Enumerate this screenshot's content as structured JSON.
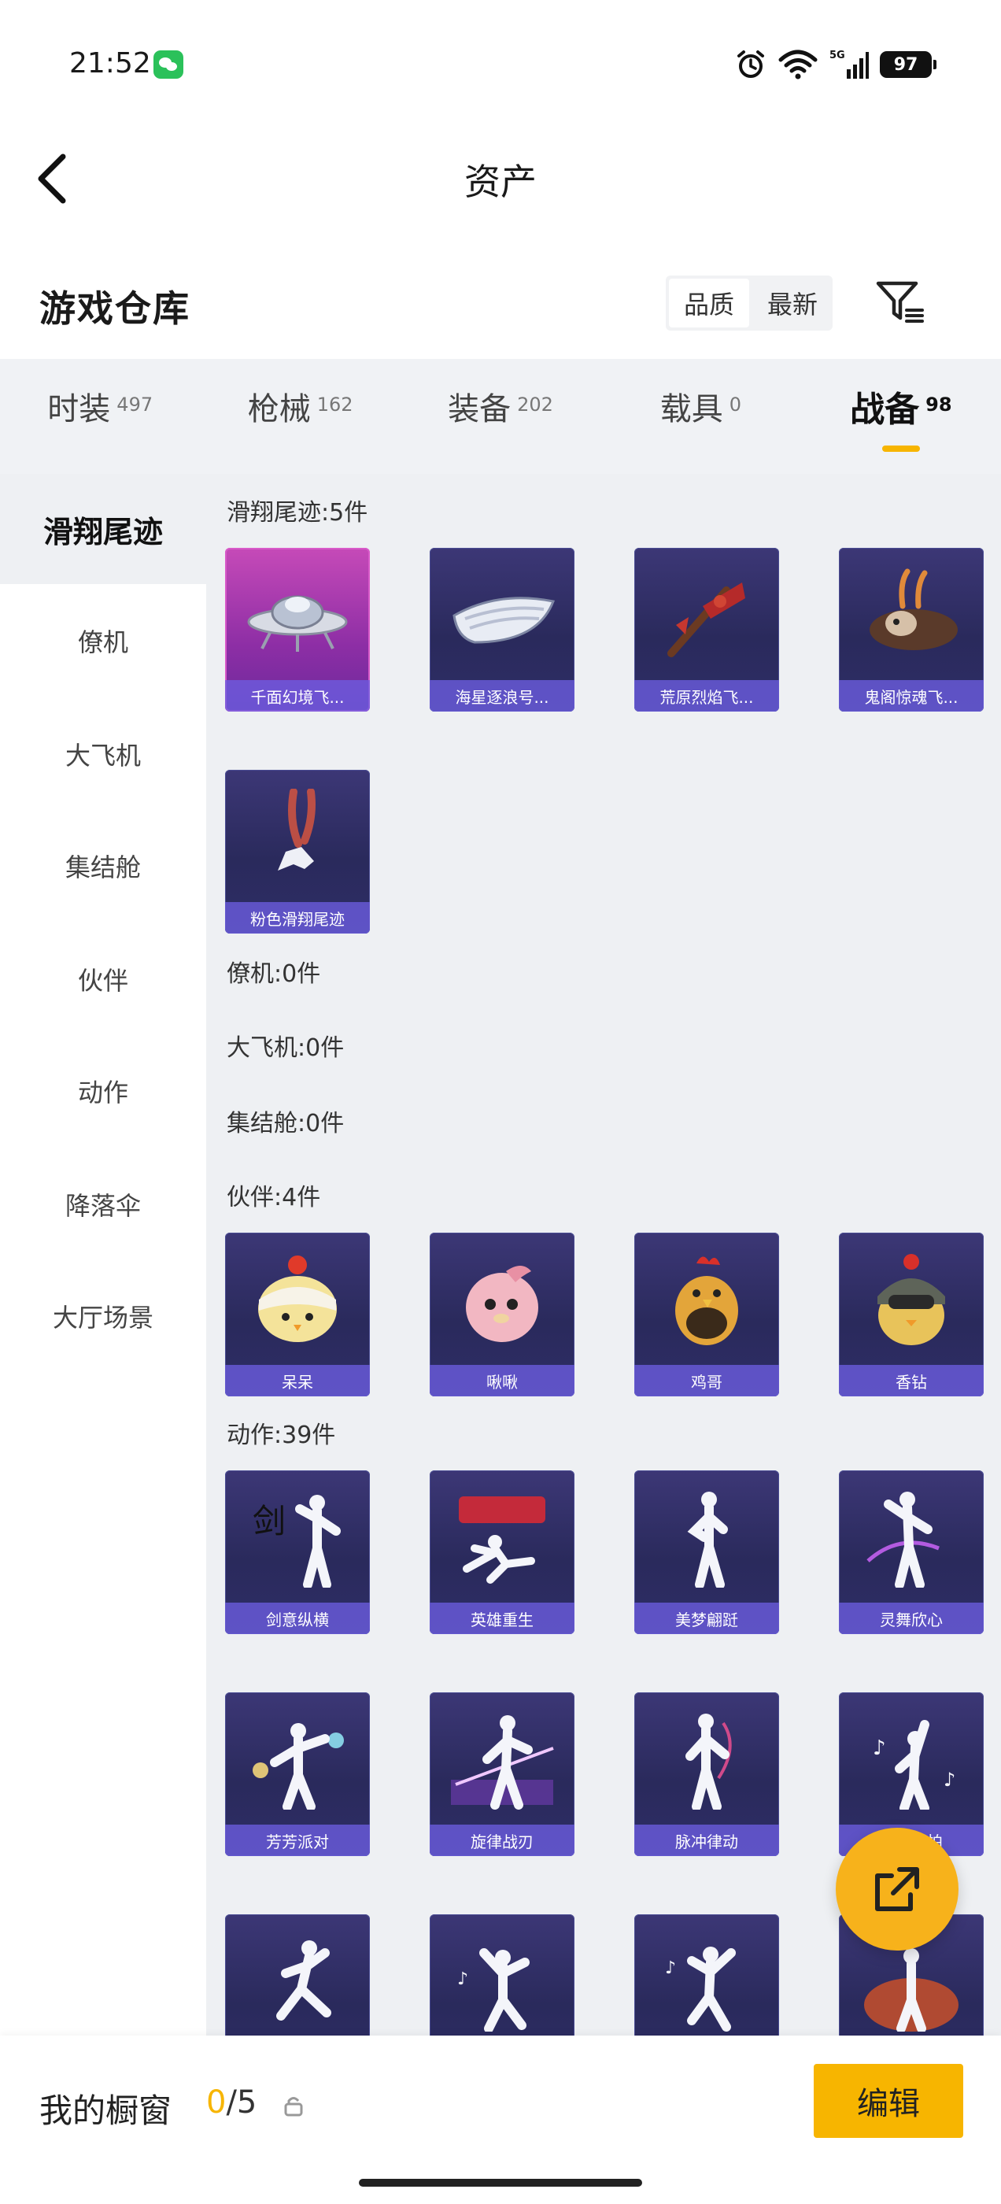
{
  "status_bar": {
    "time": "21:52",
    "network": "5G",
    "battery": "97"
  },
  "nav": {
    "title": "资产"
  },
  "section": {
    "title": "游戏仓库",
    "sort_options": [
      "品质",
      "最新"
    ]
  },
  "tabs": [
    {
      "label": "时装",
      "count": "497"
    },
    {
      "label": "枪械",
      "count": "162"
    },
    {
      "label": "装备",
      "count": "202"
    },
    {
      "label": "载具",
      "count": "0"
    },
    {
      "label": "战备",
      "count": "98",
      "active": true
    }
  ],
  "sidebar": {
    "items": [
      "滑翔尾迹",
      "僚机",
      "大飞机",
      "集结舱",
      "伙伴",
      "动作",
      "降落伞",
      "大厅场景"
    ]
  },
  "groups": {
    "trail": {
      "title": "滑翔尾迹:5件",
      "items": [
        "千面幻境飞...",
        "海星逐浪号...",
        "荒原烈焰飞...",
        "鬼阁惊魂飞...",
        "粉色滑翔尾迹"
      ]
    },
    "wingman": {
      "title": "僚机:0件"
    },
    "aircraft": {
      "title": "大飞机:0件"
    },
    "pod": {
      "title": "集结舱:0件"
    },
    "partner": {
      "title": "伙伴:4件",
      "items": [
        "呆呆",
        "啾啾",
        "鸡哥",
        "香钻"
      ]
    },
    "emote": {
      "title": "动作:39件",
      "items": [
        "剑意纵横",
        "英雄重生",
        "美梦翩跹",
        "灵舞欣心",
        "芳芳派对",
        "旋律战刃",
        "脉冲律动",
        "自由节拍",
        "",
        "",
        "",
        ""
      ]
    }
  },
  "bottom_bar": {
    "showcase_label": "我的橱窗",
    "showcase_current": "0",
    "showcase_total": "/5",
    "edit_label": "编辑"
  },
  "colors": {
    "accent": "#f7b500",
    "card_bg": "#2e2d66",
    "card_label": "#6c5ee0",
    "pink_card": "#c64ab8"
  }
}
